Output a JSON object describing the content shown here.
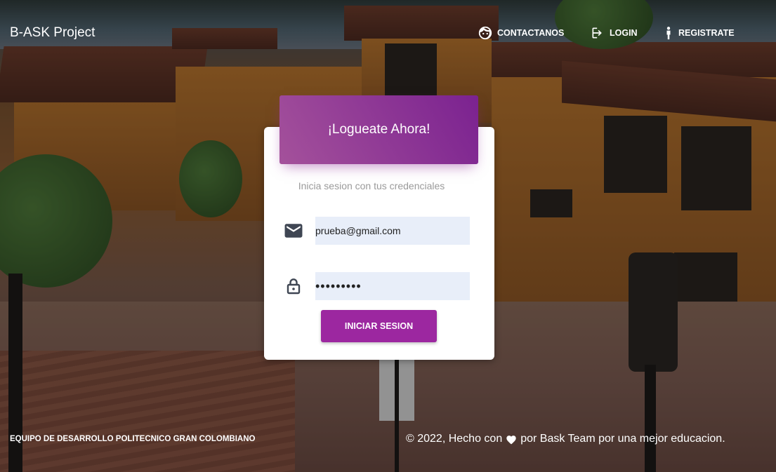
{
  "navbar": {
    "brand": "B-ASK Project",
    "links": [
      {
        "label": "CONTACTANOS",
        "icon": "face-icon"
      },
      {
        "label": "LOGIN",
        "icon": "login-icon"
      },
      {
        "label": "REGISTRATE",
        "icon": "person-icon"
      }
    ]
  },
  "login_card": {
    "title": "¡Logueate Ahora!",
    "subtitle": "Inicia sesion con tus credenciales",
    "email": {
      "value": "prueba@gmail.com",
      "icon": "mail-icon"
    },
    "password": {
      "value": "123456789",
      "icon": "lock-icon"
    },
    "submit_label": "INICIAR SESION"
  },
  "footer": {
    "left": "EQUIPO DE DESARROLLO POLITECNICO GRAN COLOMBIANO",
    "right_prefix": "© 2022, Hecho con",
    "right_suffix": "por Bask Team por una mejor educacion.",
    "heart_icon": "heart-icon"
  },
  "colors": {
    "accent": "#9c27a0",
    "header_gradient_start": "#a4519b",
    "header_gradient_end": "#7b2290",
    "input_bg": "#e8eef9"
  }
}
